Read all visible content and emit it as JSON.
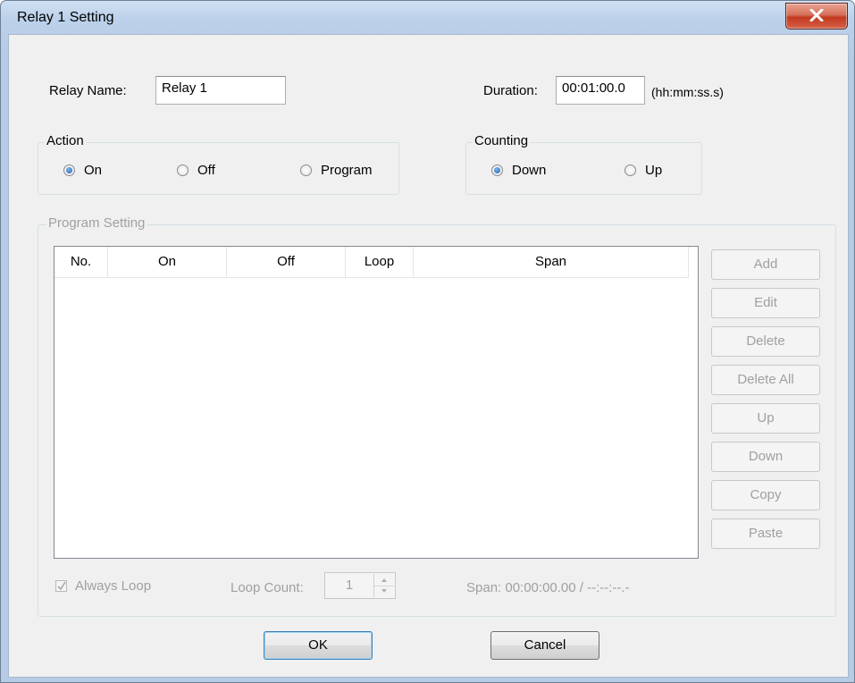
{
  "window": {
    "title": "Relay 1 Setting"
  },
  "relay_name": {
    "label": "Relay Name:",
    "value": "Relay 1"
  },
  "duration": {
    "label": "Duration:",
    "value": "00:01:00.0",
    "format_hint": "(hh:mm:ss.s)"
  },
  "action": {
    "title": "Action",
    "options": [
      {
        "label": "On",
        "checked": true
      },
      {
        "label": "Off",
        "checked": false
      },
      {
        "label": "Program",
        "checked": false
      }
    ]
  },
  "counting": {
    "title": "Counting",
    "options": [
      {
        "label": "Down",
        "checked": true
      },
      {
        "label": "Up",
        "checked": false
      }
    ]
  },
  "program_setting": {
    "title": "Program Setting",
    "columns": [
      "No.",
      "On",
      "Off",
      "Loop",
      "Span"
    ],
    "rows": [],
    "buttons": [
      "Add",
      "Edit",
      "Delete",
      "Delete All",
      "Up",
      "Down",
      "Copy",
      "Paste"
    ],
    "always_loop": {
      "label": "Always Loop",
      "checked": true
    },
    "loop_count": {
      "label": "Loop Count:",
      "value": "1"
    },
    "span_text": "Span: 00:00:00.00 / --:--:--.-"
  },
  "footer": {
    "ok_label": "OK",
    "cancel_label": "Cancel"
  },
  "colors": {
    "title_bar": "#b9cee8",
    "close_button": "#c7432b",
    "dialog_bg": "#f0f0f0",
    "disabled_text": "#a0a0a0"
  }
}
